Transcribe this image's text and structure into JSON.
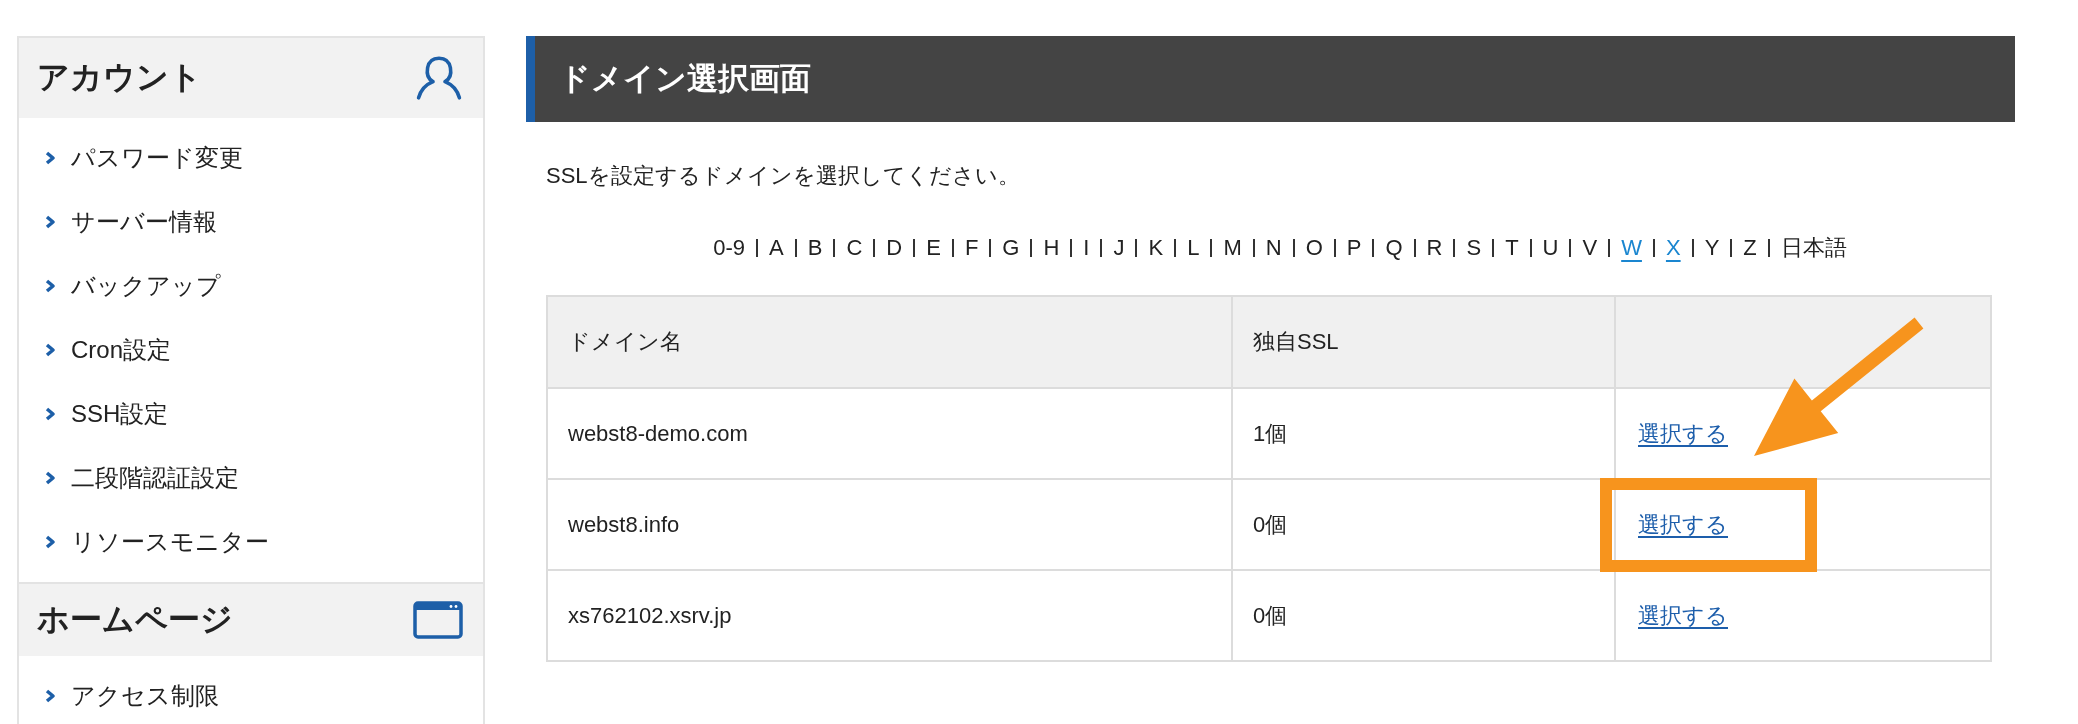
{
  "sidebar": {
    "sections": [
      {
        "title": "アカウント",
        "items": [
          "パスワード変更",
          "サーバー情報",
          "バックアップ",
          "Cron設定",
          "SSH設定",
          "二段階認証設定",
          "リソースモニター"
        ]
      },
      {
        "title": "ホームページ",
        "items": [
          "アクセス制限"
        ]
      }
    ]
  },
  "main": {
    "title": "ドメイン選択画面",
    "instruction": "SSLを設定するドメインを選択してください。",
    "index_nav": [
      {
        "label": "0-9",
        "linked": false
      },
      {
        "label": "A",
        "linked": false
      },
      {
        "label": "B",
        "linked": false
      },
      {
        "label": "C",
        "linked": false
      },
      {
        "label": "D",
        "linked": false
      },
      {
        "label": "E",
        "linked": false
      },
      {
        "label": "F",
        "linked": false
      },
      {
        "label": "G",
        "linked": false
      },
      {
        "label": "H",
        "linked": false
      },
      {
        "label": "I",
        "linked": false
      },
      {
        "label": "J",
        "linked": false
      },
      {
        "label": "K",
        "linked": false
      },
      {
        "label": "L",
        "linked": false
      },
      {
        "label": "M",
        "linked": false
      },
      {
        "label": "N",
        "linked": false
      },
      {
        "label": "O",
        "linked": false
      },
      {
        "label": "P",
        "linked": false
      },
      {
        "label": "Q",
        "linked": false
      },
      {
        "label": "R",
        "linked": false
      },
      {
        "label": "S",
        "linked": false
      },
      {
        "label": "T",
        "linked": false
      },
      {
        "label": "U",
        "linked": false
      },
      {
        "label": "V",
        "linked": false
      },
      {
        "label": "W",
        "linked": true
      },
      {
        "label": "X",
        "linked": true
      },
      {
        "label": "Y",
        "linked": false
      },
      {
        "label": "Z",
        "linked": false
      },
      {
        "label": "日本語",
        "linked": false
      }
    ],
    "table": {
      "columns": [
        "ドメイン名",
        "独自SSL"
      ],
      "rows": [
        {
          "domain": "webst8-demo.com",
          "ssl_count": "1個",
          "action": "選択する",
          "highlighted": false
        },
        {
          "domain": "webst8.info",
          "ssl_count": "0個",
          "action": "選択する",
          "highlighted": true
        },
        {
          "domain": "xs762102.xsrv.jp",
          "ssl_count": "0個",
          "action": "選択する",
          "highlighted": false
        }
      ]
    }
  }
}
